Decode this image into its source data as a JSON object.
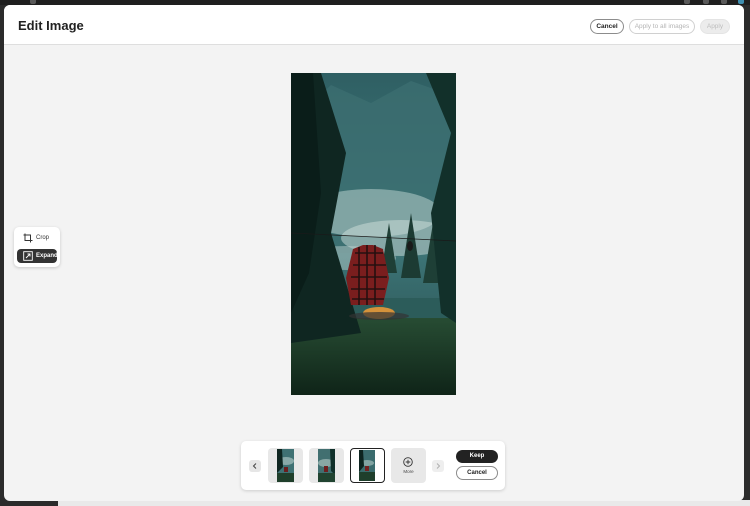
{
  "window": {
    "title": "Edit Image"
  },
  "header": {
    "cancel_label": "Cancel",
    "apply_all_label": "Apply to all images",
    "apply_label": "Apply"
  },
  "tools": {
    "crop_label": "Crop",
    "crop_icon": "crop-icon",
    "expand_label": "Expand",
    "expand_icon": "expand-icon",
    "active": "Expand"
  },
  "thumbnails": {
    "count": 3,
    "selected_index": 2,
    "more_label": "More",
    "prev_icon": "chevron-left-icon",
    "next_icon": "chevron-right-icon",
    "add_icon": "plus-circle-icon"
  },
  "actions": {
    "keep_label": "Keep",
    "cancel_label": "Cancel"
  },
  "colors": {
    "accent_dark": "#222222",
    "modal_bg": "#f3f3f3",
    "disabled_text": "#b4b4b4"
  }
}
